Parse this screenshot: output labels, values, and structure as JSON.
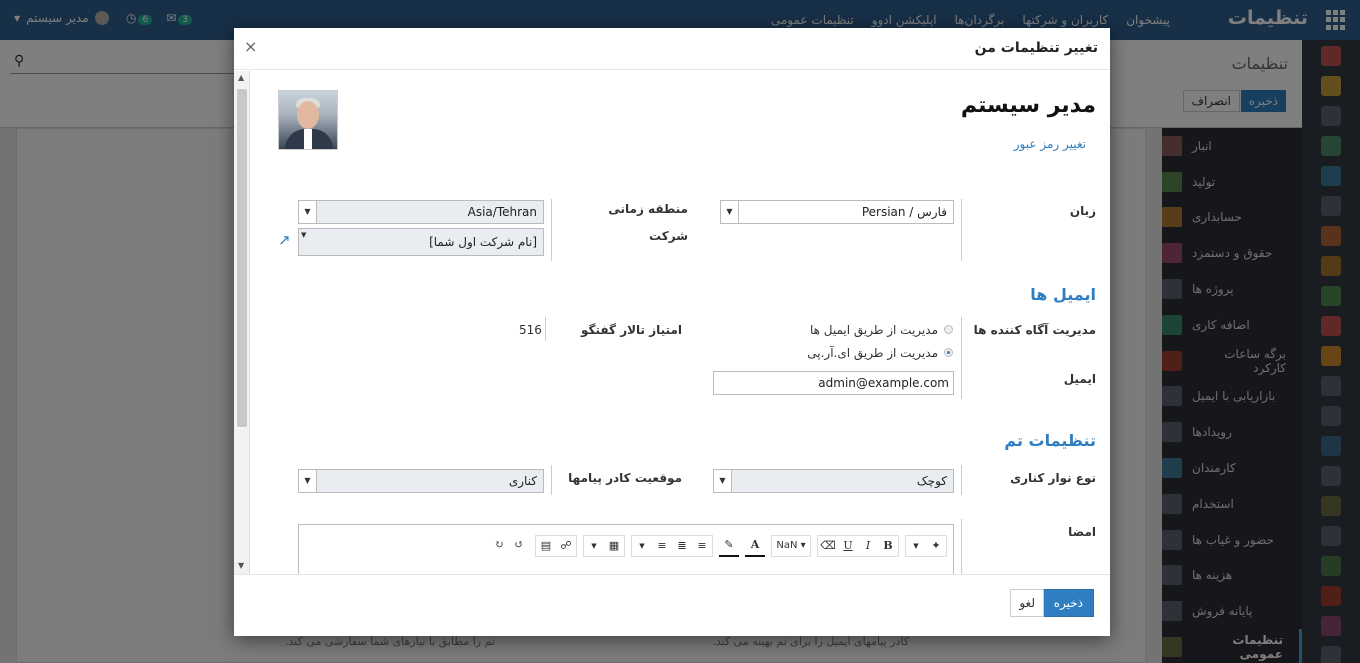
{
  "topbar": {
    "brand": "تنظیمات",
    "menu": [
      "پیشخوان",
      "کاربران و شرکتها",
      "برگردان‌ها",
      "اپلیکشن ادوو",
      "تنظیمات عمومی"
    ],
    "user_name": "مدیر سیستم",
    "messages_count": "3",
    "activities_count": "6"
  },
  "page": {
    "title": "تنظیمات",
    "save_label": "ذخیره",
    "discard_label": "انصراف"
  },
  "sidebar": {
    "items": [
      {
        "label": "انبار",
        "color": "#8e5b5b"
      },
      {
        "label": "تولید",
        "color": "#5a8a4d"
      },
      {
        "label": "حسابداری",
        "color": "#b07a3a"
      },
      {
        "label": "حقوق و دستمزد",
        "color": "#9b4b6e"
      },
      {
        "label": "پروژه ها",
        "color": "#5d6470"
      },
      {
        "label": "اضافه کاری",
        "color": "#3a8a6a"
      },
      {
        "label": "برگه ساعات کارکرد",
        "color": "#a0402e"
      },
      {
        "label": "بازاریابی با ایمیل",
        "color": "#5d6470"
      },
      {
        "label": "رویدادها",
        "color": "#5d6470"
      },
      {
        "label": "کارمندان",
        "color": "#3c7a9a"
      },
      {
        "label": "استخدام",
        "color": "#5d6470"
      },
      {
        "label": "حضور و غیاب ها",
        "color": "#5d6470"
      },
      {
        "label": "هزینه ها",
        "color": "#5d6470"
      },
      {
        "label": "پایانه فروش",
        "color": "#5d6470"
      },
      {
        "label": "تنظیمات عمومی",
        "color": "#6b6f40"
      }
    ]
  },
  "background": {
    "footnote_right": "کادر پیامهای ایمیل را برای تم بهینه می کند.",
    "footnote_left": "تم را مطابق با نیازهای شما سفارشی می کند."
  },
  "modal": {
    "title": "تغییر تنظیمات من",
    "close_glyph": "×",
    "user_name": "مدیر سیستم",
    "change_password": "تغییر رمز عبور",
    "language_label": "زبان",
    "language_value": "Persian / فارس",
    "timezone_label": "منطقه زمانی",
    "timezone_value": "Asia/Tehran",
    "company_label": "شرکت",
    "company_value": "[نام شرکت اول شما]",
    "emails_section": "ایمیل ها",
    "notification_label": "مدیریت آگاه کننده ها",
    "notification_options": [
      "مدیریت از طریق ایمیل ها",
      "مدیریت از طریق ای.آر.پی"
    ],
    "notification_selected": 1,
    "karma_label": "امتیاز تالار گفتگو",
    "karma_value": "516",
    "email_label": "ایمیل",
    "email_value": "admin@example.com",
    "theme_section": "تنظیمات تم",
    "sidebar_type_label": "نوع نوار کناری",
    "sidebar_type_value": "کوچک",
    "chatter_position_label": "موقعیت کادر پیامها",
    "chatter_position_value": "کناری",
    "signature_label": "امضا",
    "font_size_value": "NaN",
    "signature_text": "--",
    "save_label": "ذخیره",
    "cancel_label": "لغو"
  }
}
